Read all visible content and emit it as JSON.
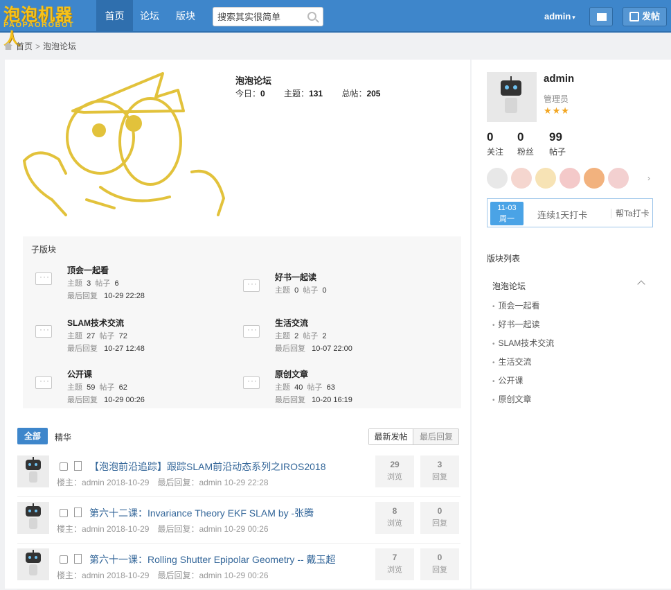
{
  "header": {
    "logo_text": "泡泡机器人",
    "logo_subtext": "PAOPAOROBOT",
    "nav": [
      "首页",
      "论坛",
      "版块"
    ],
    "search_placeholder": "搜索其实很简单",
    "username": "admin",
    "caret": "▾",
    "post_label": "发帖",
    "accent_color": "#3e86cb"
  },
  "breadcrumb": {
    "home": "首页",
    "sep": ">",
    "current": "泡泡论坛"
  },
  "forum": {
    "name": "泡泡论坛",
    "today_label": "今日：",
    "today": "0",
    "topics_label": "主题：",
    "topics": "131",
    "posts_label": "总帖：",
    "posts": "205"
  },
  "subforums": {
    "title": "子版块",
    "topic_label": "主题",
    "post_label": "帖子",
    "last_label": "最后回复",
    "items": [
      {
        "name": "顶会一起看",
        "topics": "3",
        "posts": "6",
        "last": "10-29 22:28",
        "has_last": true
      },
      {
        "name": "好书一起读",
        "topics": "0",
        "posts": "0",
        "last": "",
        "has_last": false
      },
      {
        "name": "SLAM技术交流",
        "topics": "27",
        "posts": "72",
        "last": "10-27 12:48",
        "has_last": true
      },
      {
        "name": "生活交流",
        "topics": "2",
        "posts": "2",
        "last": "10-07 22:00",
        "has_last": true
      },
      {
        "name": "公开课",
        "topics": "59",
        "posts": "62",
        "last": "10-29 00:26",
        "has_last": true
      },
      {
        "name": "原创文章",
        "topics": "40",
        "posts": "63",
        "last": "10-20 16:19",
        "has_last": true
      }
    ]
  },
  "filter": {
    "all": "全部",
    "elite": "精华",
    "sort_new": "最新发帖",
    "sort_reply": "最后回复"
  },
  "threads": [
    {
      "title": "【泡泡前沿追踪】跟踪SLAM前沿动态系列之IROS2018",
      "author_label": "楼主：",
      "author": "admin",
      "date": "2018-10-29",
      "last_label": "最后回复：",
      "last_user": "admin",
      "last_time": "10-29 22:28",
      "views": "29",
      "replies": "3"
    },
    {
      "title": "第六十二课：Invariance Theory EKF SLAM by -张腾",
      "author_label": "楼主：",
      "author": "admin",
      "date": "2018-10-29",
      "last_label": "最后回复：",
      "last_user": "admin",
      "last_time": "10-29 00:26",
      "views": "8",
      "replies": "0"
    },
    {
      "title": "第六十一课：Rolling Shutter Epipolar Geometry -- 戴玉超",
      "author_label": "楼主：",
      "author": "admin",
      "date": "2018-10-29",
      "last_label": "最后回复：",
      "last_user": "admin",
      "last_time": "10-29 00:26",
      "views": "7",
      "replies": "0"
    }
  ],
  "thread_labels": {
    "views": "浏览",
    "replies": "回复"
  },
  "profile": {
    "name": "admin",
    "role": "管理员",
    "stars": "★★★",
    "follow": "0",
    "follow_label": "关注",
    "fans": "0",
    "fans_label": "粉丝",
    "posts": "99",
    "posts_label": "帖子",
    "badge_colors": [
      "#e8e8e8",
      "#f5d6cf",
      "#f7e3b5",
      "#f4c9c9",
      "#f2b27e",
      "#f3d0d0"
    ],
    "badge_next": "›"
  },
  "signin": {
    "date_top": "11-03",
    "date_bottom": "周一",
    "days": "连续1天打卡",
    "mark": "帮Ta打卡"
  },
  "board_list": {
    "title": "版块列表",
    "top": "泡泡论坛",
    "items": [
      "顶会一起看",
      "好书一起读",
      "SLAM技术交流",
      "生活交流",
      "公开课",
      "原创文章"
    ]
  }
}
